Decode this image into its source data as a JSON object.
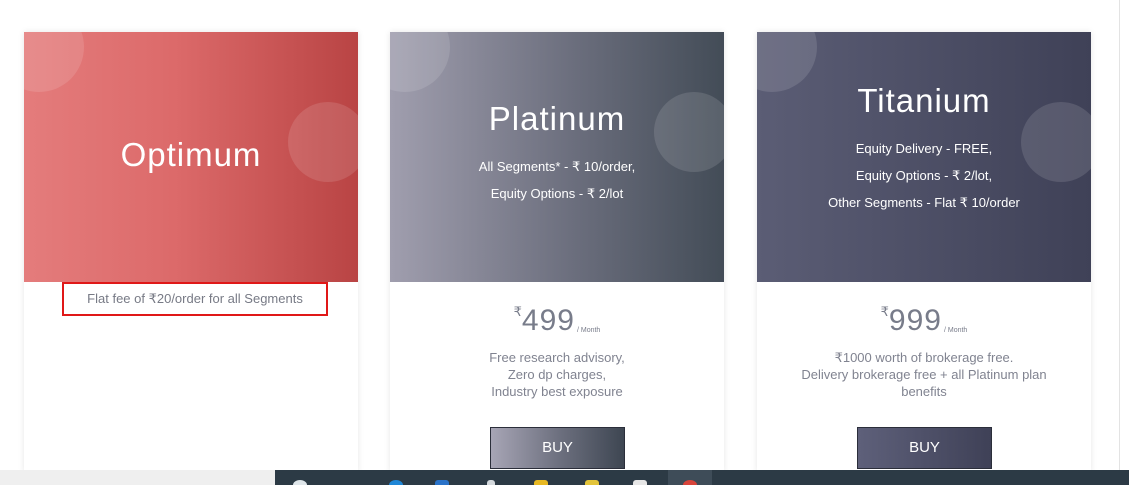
{
  "plans": [
    {
      "name": "Optimum",
      "note": "Flat fee of ₹20/order for all Segments"
    },
    {
      "name": "Platinum",
      "features": [
        "All Segments* - ₹ 10/order,",
        "Equity Options - ₹ 2/lot"
      ],
      "currency": "₹",
      "price": "499",
      "period": "/ Month",
      "benefits": [
        "Free research advisory,",
        "Zero dp charges,",
        "Industry best exposure"
      ],
      "buy_label": "BUY"
    },
    {
      "name": "Titanium",
      "features": [
        "Equity Delivery - FREE,",
        "Equity Options - ₹ 2/lot,",
        "Other Segments - Flat ₹ 10/order"
      ],
      "currency": "₹",
      "price": "999",
      "period": "/ Month",
      "benefits": [
        "₹1000 worth of brokerage free.",
        "Delivery brokerage free + all Platinum plan",
        "benefits"
      ],
      "buy_label": "BUY"
    }
  ],
  "colors": {
    "highlight_border": "#e01818",
    "optimum_gradient": [
      "#e47c7c",
      "#b94444"
    ],
    "platinum_gradient": [
      "#a09eae",
      "#434c57"
    ],
    "titanium_gradient": [
      "#5b5d75",
      "#3f4157"
    ]
  },
  "taskbar": {
    "icons": [
      "search-icon",
      "browser-icon",
      "mail-icon",
      "paperclip-icon",
      "folder-icon",
      "app-icon",
      "document-icon",
      "chrome-icon"
    ]
  }
}
